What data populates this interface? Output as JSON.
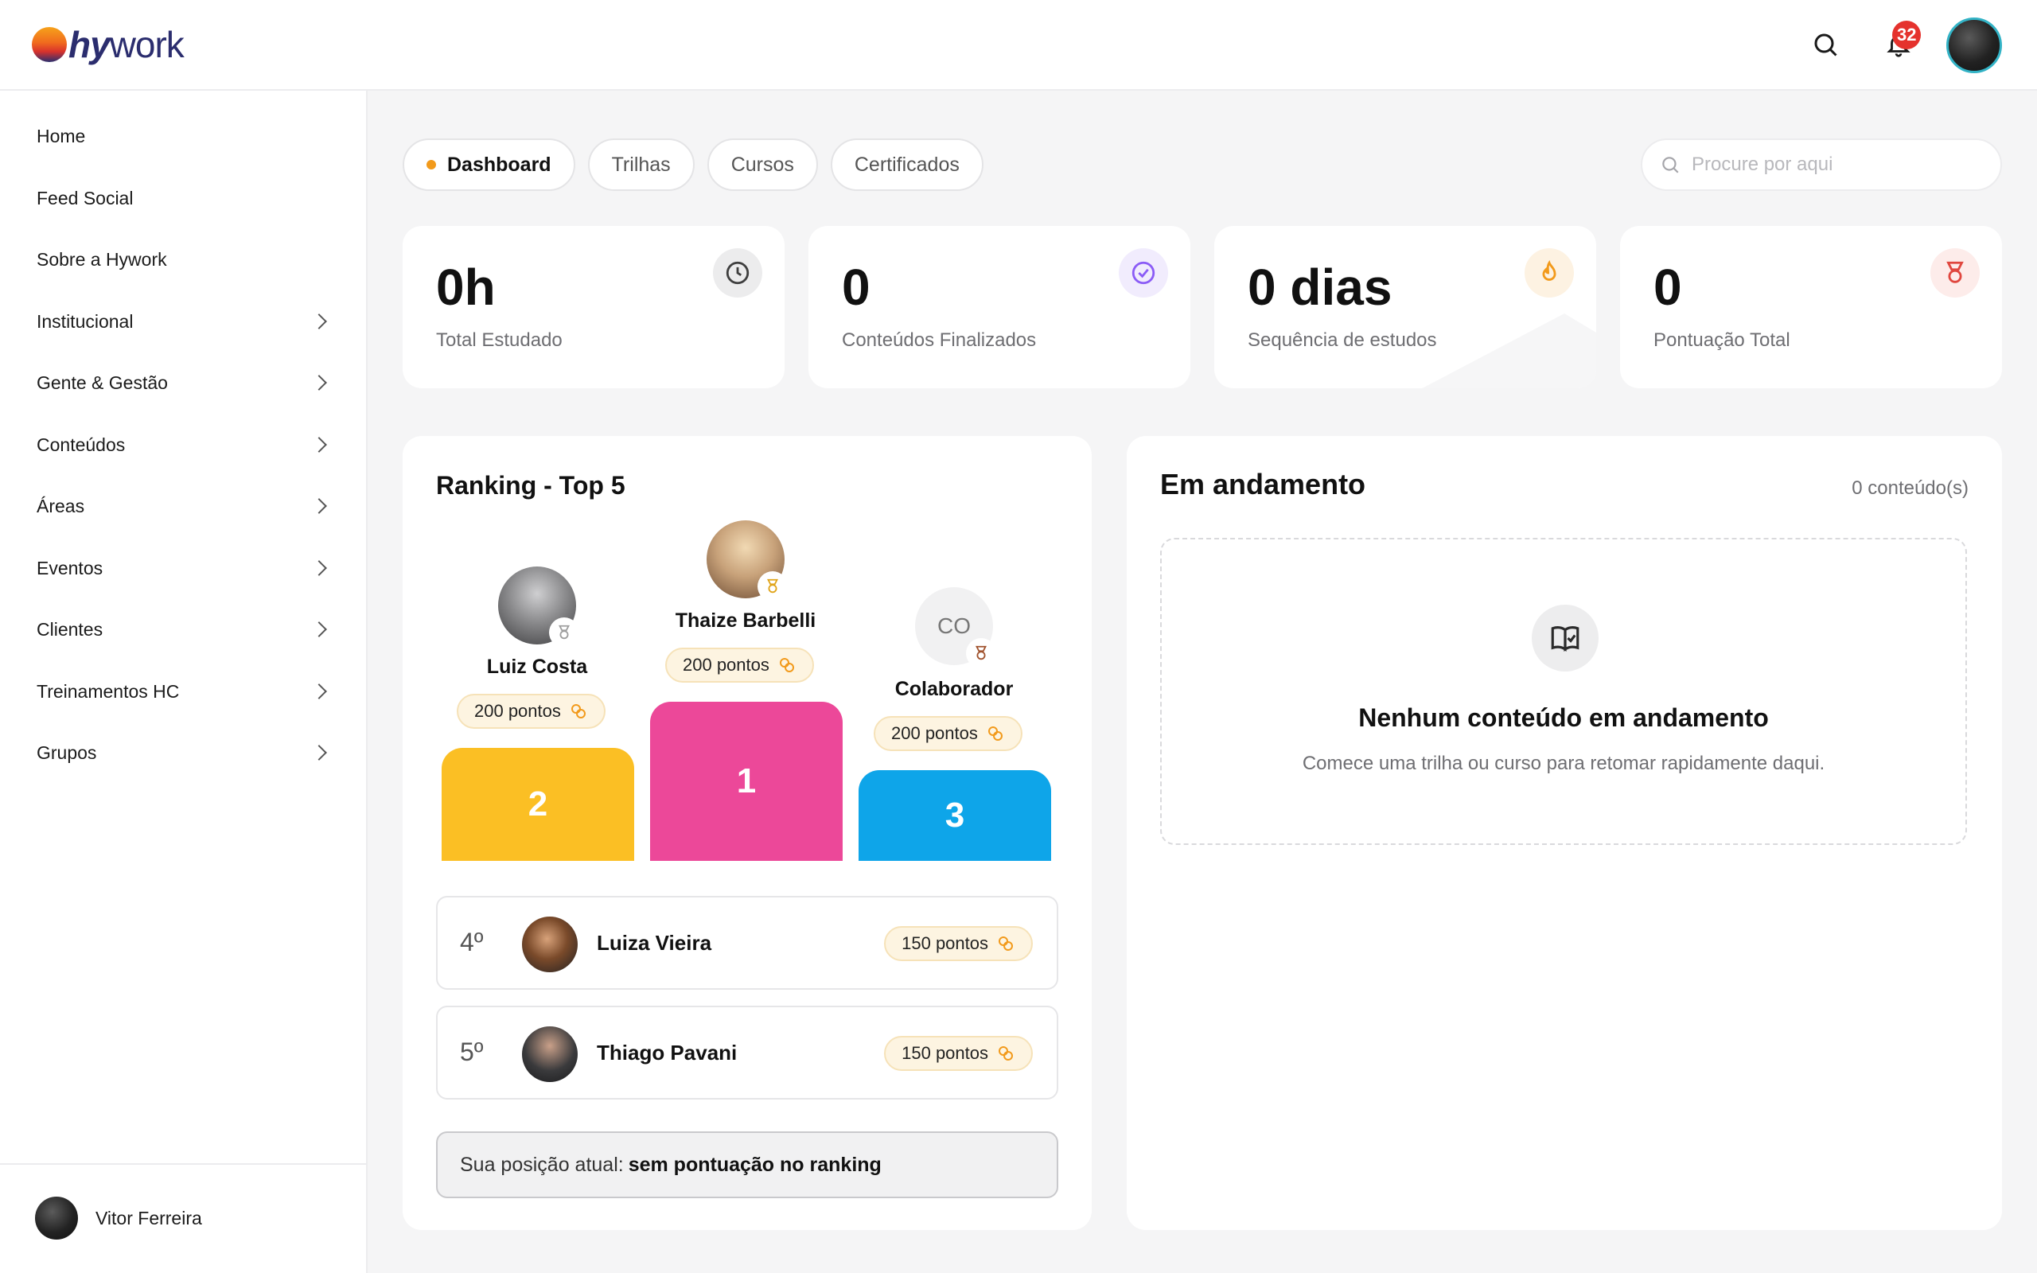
{
  "brand": {
    "logo_part1": "hy",
    "logo_part2": "work"
  },
  "topbar": {
    "notification_count": "32"
  },
  "sidebar": {
    "items": [
      {
        "label": "Home",
        "chevron": false
      },
      {
        "label": "Feed Social",
        "chevron": false
      },
      {
        "label": "Sobre a Hywork",
        "chevron": false
      },
      {
        "label": "Institucional",
        "chevron": true
      },
      {
        "label": "Gente & Gestão",
        "chevron": true
      },
      {
        "label": "Conteúdos",
        "chevron": true
      },
      {
        "label": "Áreas",
        "chevron": true
      },
      {
        "label": "Eventos",
        "chevron": true
      },
      {
        "label": "Clientes",
        "chevron": true
      },
      {
        "label": "Treinamentos HC",
        "chevron": true
      },
      {
        "label": "Grupos",
        "chevron": true
      }
    ],
    "user_name": "Vitor Ferreira"
  },
  "tabs": [
    {
      "label": "Dashboard",
      "active": true
    },
    {
      "label": "Trilhas",
      "active": false
    },
    {
      "label": "Cursos",
      "active": false
    },
    {
      "label": "Certificados",
      "active": false
    }
  ],
  "search": {
    "placeholder": "Procure por aqui"
  },
  "stats": [
    {
      "value": "0h",
      "label": "Total Estudado",
      "icon": "clock-icon",
      "icon_color": "#4a4a4a",
      "icon_bg": "#efefef"
    },
    {
      "value": "0",
      "label": "Conteúdos Finalizados",
      "icon": "check-circle-icon",
      "icon_color": "#8b5cf6",
      "icon_bg": "#f1ecfd"
    },
    {
      "value": "0 dias",
      "label": "Sequência de estudos",
      "icon": "flame-icon",
      "icon_color": "#f29a1b",
      "icon_bg": "#fdf2e2"
    },
    {
      "value": "0",
      "label": "Pontuação Total",
      "icon": "medal-icon",
      "icon_color": "#e0473f",
      "icon_bg": "#fdecea"
    }
  ],
  "ranking": {
    "title": "Ranking - Top 5",
    "podium": [
      {
        "place": "2",
        "name": "Luiz Costa",
        "points": "200 pontos",
        "color": "#fbbf24",
        "medal_color": "#9e9e9e"
      },
      {
        "place": "1",
        "name": "Thaize Barbelli",
        "points": "200 pontos",
        "color": "#ec4899",
        "medal_color": "#e0a418"
      },
      {
        "place": "3",
        "name": "Colaborador",
        "initials": "CO",
        "points": "200 pontos",
        "color": "#0ea5e9",
        "medal_color": "#a0522d"
      }
    ],
    "list": [
      {
        "position": "4º",
        "name": "Luiza Vieira",
        "points": "150 pontos"
      },
      {
        "position": "5º",
        "name": "Thiago Pavani",
        "points": "150 pontos"
      }
    ],
    "my_position_label": "Sua posição atual:",
    "my_position_value": "sem pontuação no ranking"
  },
  "in_progress": {
    "title": "Em andamento",
    "count": "0 conteúdo(s)",
    "empty_title": "Nenhum conteúdo em andamento",
    "empty_desc": "Comece uma trilha ou curso para retomar rapidamente daqui."
  }
}
